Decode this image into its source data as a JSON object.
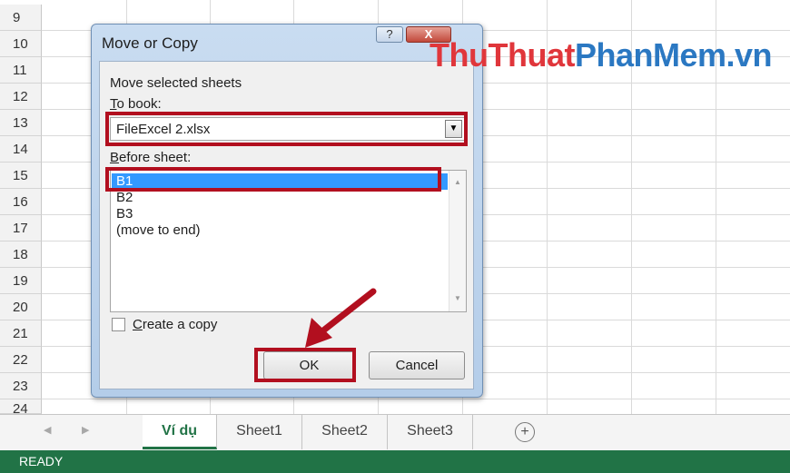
{
  "sheet": {
    "row_numbers": [
      "9",
      "10",
      "11",
      "12",
      "13",
      "14",
      "15",
      "16",
      "17",
      "18",
      "19",
      "20",
      "21",
      "22",
      "23",
      "24"
    ]
  },
  "dialog": {
    "title": "Move or Copy",
    "help_label": "?",
    "close_label": "X",
    "move_selected_label": "Move selected sheets",
    "to_book_label_key": "T",
    "to_book_label_rest": "o book:",
    "to_book_value": "FileExcel 2.xlsx",
    "before_sheet_label_key": "B",
    "before_sheet_label_rest": "efore sheet:",
    "before_sheet_items": [
      "B1",
      "B2",
      "B3",
      "(move to end)"
    ],
    "selected_item": "B1",
    "create_copy_key": "C",
    "create_copy_rest": "reate a copy",
    "create_copy_checked": false,
    "ok_label": "OK",
    "cancel_label": "Cancel"
  },
  "tabs": {
    "items": [
      "Ví dụ",
      "Sheet1",
      "Sheet2",
      "Sheet3"
    ],
    "active": "Ví dụ",
    "add_icon": "plus-circle-icon",
    "prev_icon": "triangle-left-icon",
    "next_icon": "triangle-right-icon"
  },
  "status": {
    "text": "READY"
  },
  "watermark": {
    "part1": "ThuThuat",
    "part2": "PhanMem",
    "part3": ".vn"
  },
  "colors": {
    "status_bar": "#217346",
    "active_tab": "#217346",
    "highlight_red": "#b20f1f",
    "selection_blue": "#3399ff",
    "watermark_red": "#e0363b",
    "watermark_blue": "#2b78c2"
  }
}
